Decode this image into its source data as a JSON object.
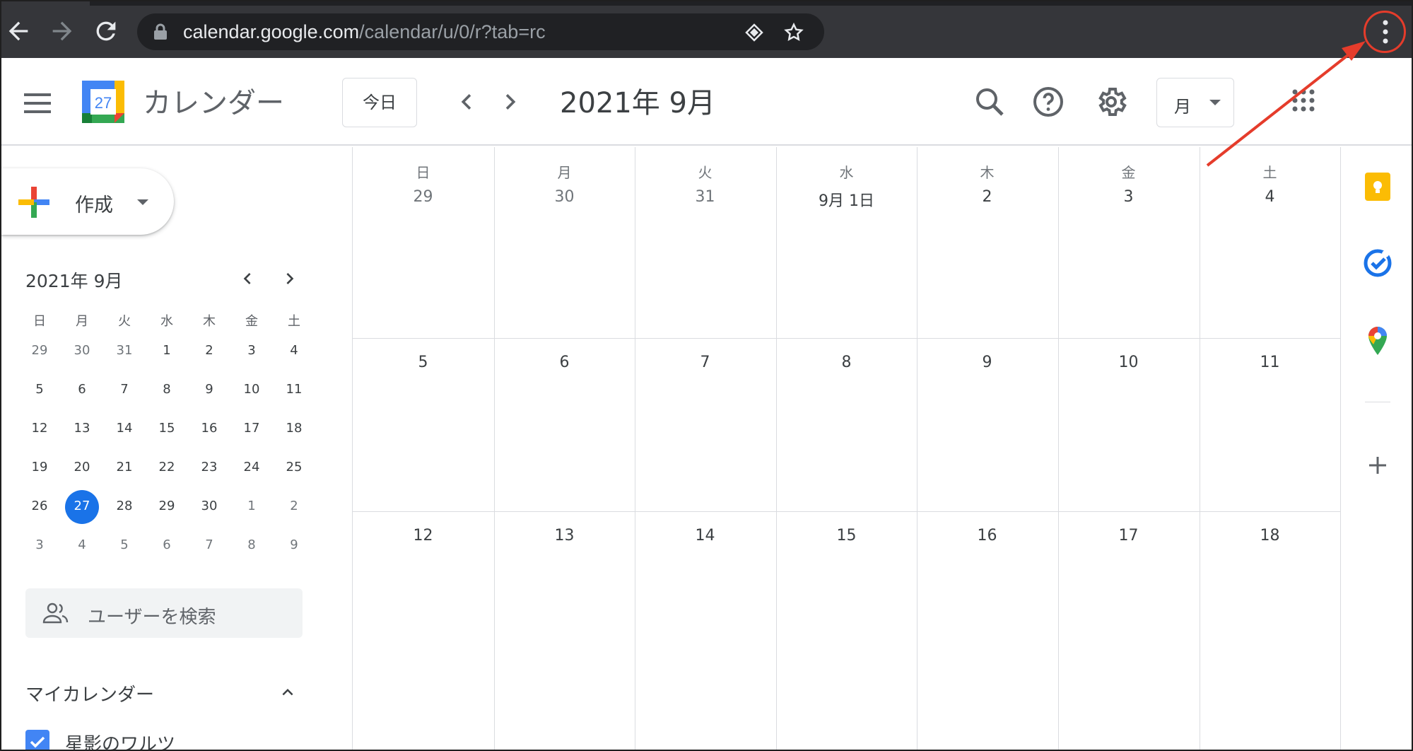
{
  "browser": {
    "url_host": "calendar.google.com",
    "url_path": "/calendar/u/0/r?tab=rc",
    "back_icon": "arrow-left-icon",
    "forward_icon": "arrow-right-icon",
    "reload_icon": "reload-icon",
    "lock_icon": "lock-icon",
    "extension_icon": "extension-diamond-icon",
    "bookmark_icon": "star-icon",
    "menu_icon": "vertical-dots-icon",
    "annotation_color": "#e53c2b"
  },
  "header": {
    "app_title": "カレンダー",
    "logo_day": "27",
    "today_label": "今日",
    "current_month": "2021年 9月",
    "view_label": "月"
  },
  "sidebar": {
    "create_label": "作成",
    "mini_calendar": {
      "title": "2021年 9月",
      "weekdays": [
        "日",
        "月",
        "火",
        "水",
        "木",
        "金",
        "土"
      ],
      "weeks": [
        [
          "29",
          "30",
          "31",
          "1",
          "2",
          "3",
          "4"
        ],
        [
          "5",
          "6",
          "7",
          "8",
          "9",
          "10",
          "11"
        ],
        [
          "12",
          "13",
          "14",
          "15",
          "16",
          "17",
          "18"
        ],
        [
          "19",
          "20",
          "21",
          "22",
          "23",
          "24",
          "25"
        ],
        [
          "26",
          "27",
          "28",
          "29",
          "30",
          "1",
          "2"
        ],
        [
          "3",
          "4",
          "5",
          "6",
          "7",
          "8",
          "9"
        ]
      ],
      "today": "27"
    },
    "people_search_placeholder": "ユーザーを検索",
    "my_calendars_label": "マイカレンダー",
    "calendars": [
      {
        "name": "星影のワルツ",
        "color": "#4285f4",
        "checked": true
      }
    ]
  },
  "month_grid": {
    "weekdays": [
      "日",
      "月",
      "火",
      "水",
      "木",
      "金",
      "土"
    ],
    "weeks": [
      [
        "29",
        "30",
        "31",
        "9月 1日",
        "2",
        "3",
        "4"
      ],
      [
        "5",
        "6",
        "7",
        "8",
        "9",
        "10",
        "11"
      ],
      [
        "12",
        "13",
        "14",
        "15",
        "16",
        "17",
        "18"
      ]
    ]
  },
  "side_panel": {
    "items": [
      "keep-icon",
      "tasks-icon",
      "maps-icon"
    ],
    "add_icon": "plus-icon"
  },
  "colors": {
    "accent": "#1a73e8",
    "chrome_bg": "#35363a"
  }
}
